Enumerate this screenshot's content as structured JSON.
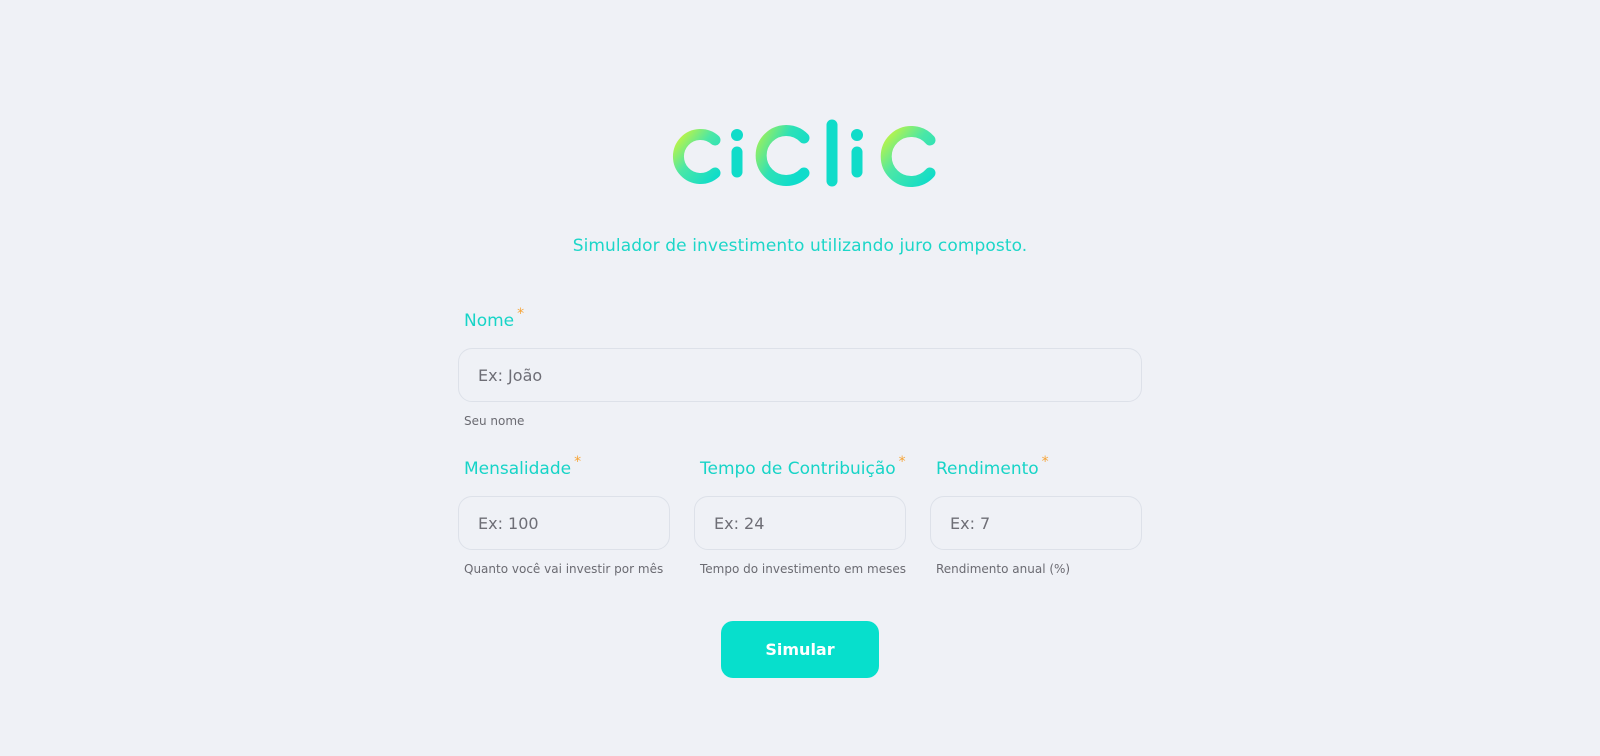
{
  "colors": {
    "background": "#eff1f6",
    "accent": "#07dfcc",
    "label": "#17d4c7",
    "required_marker": "#f6a335",
    "logo_gradient_light": "#b8f542"
  },
  "brand": {
    "logo_text": "ciclic",
    "subtitle": "Simulador de investimento utilizando juro composto."
  },
  "form": {
    "required_marker": "*",
    "nome": {
      "label": "Nome",
      "placeholder": "Ex: João",
      "hint": "Seu nome"
    },
    "mensalidade": {
      "label": "Mensalidade",
      "placeholder": "Ex: 100",
      "hint": "Quanto você vai investir por mês"
    },
    "tempo": {
      "label": "Tempo de Contribuição",
      "placeholder": "Ex: 24",
      "hint": "Tempo do investimento em meses"
    },
    "rendimento": {
      "label": "Rendimento",
      "placeholder": "Ex: 7",
      "hint": "Rendimento anual (%)"
    },
    "submit_label": "Simular"
  }
}
